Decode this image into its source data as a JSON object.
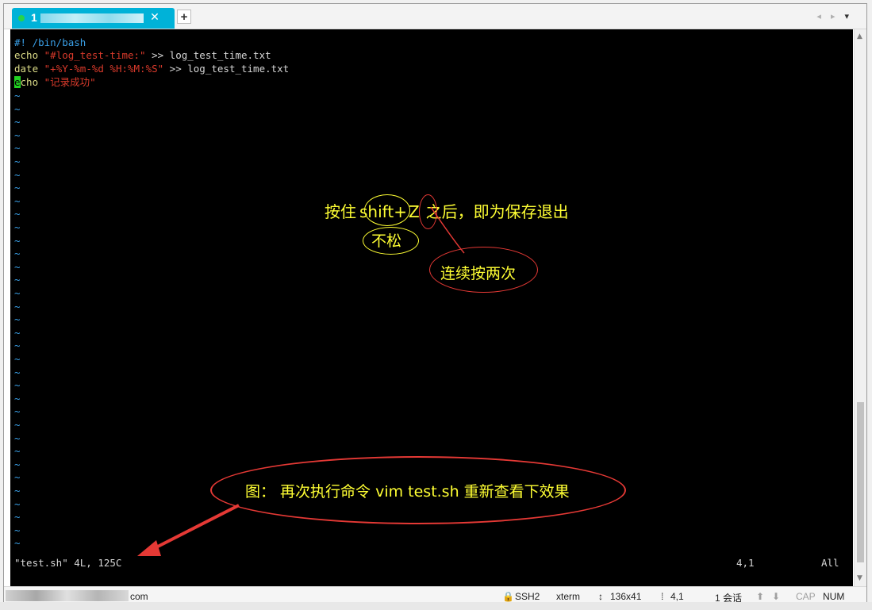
{
  "tab": {
    "label": "1"
  },
  "new_tab_label": "+",
  "terminal": {
    "line1": {
      "text": "#! /bin/bash"
    },
    "line2": {
      "cmd": "echo",
      "sp1": " ",
      "str": "\"#log_test-time:\"",
      "rest": " >> log_test_time.txt"
    },
    "line3": {
      "cmd": "date",
      "sp1": " ",
      "str": "\"+%Y-%m-%d %H:%M:%S\"",
      "rest": " >> log_test_time.txt"
    },
    "line4": {
      "cursor_char": "e",
      "cmd_rest": "cho",
      "sp1": " ",
      "str": "\"记录成功\""
    },
    "tilde": "~",
    "status_left": "\"test.sh\" 4L, 125C",
    "status_pos": "4,1",
    "status_all": "All"
  },
  "annotations": {
    "hint_prefix": "按住",
    "hint_shift": "shift",
    "hint_plus": "+",
    "hint_z": "Z",
    "hint_suffix": "之后，即为保存退出",
    "hold": "不松",
    "twice": "连续按两次",
    "caption": "图：  再次执行命令 vim test.sh 重新查看下效果"
  },
  "statusbar": {
    "host_suffix": "com",
    "ssh": "SSH2",
    "term": "xterm",
    "size": "136x41",
    "cursor": "4,1",
    "sessions": "1 会话",
    "cap": "CAP",
    "num": "NUM"
  },
  "colors": {
    "terminal_bg": "#000000",
    "tab_active": "#00b2d8",
    "annotation_text": "#ffff33",
    "annotation_red": "#e53935",
    "keyword": "#dcdc88",
    "string": "#d93a2b",
    "comment": "#3aa0e8"
  }
}
